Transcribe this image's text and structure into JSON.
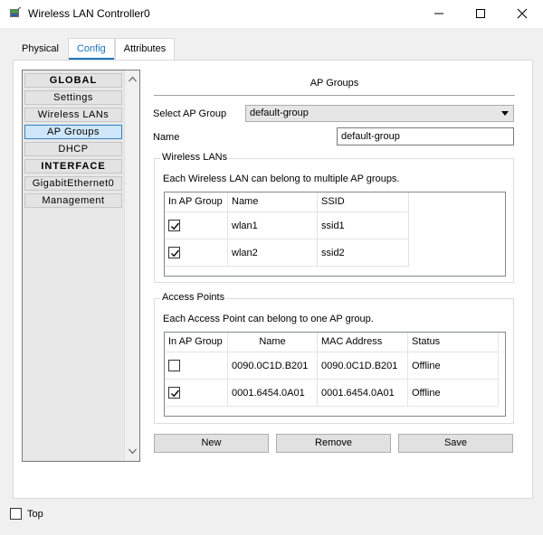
{
  "window": {
    "title": "Wireless LAN Controller0"
  },
  "tabs": [
    {
      "label": "Physical",
      "active": false
    },
    {
      "label": "Config",
      "active": true
    },
    {
      "label": "Attributes",
      "active": false
    }
  ],
  "sidebar": {
    "items": [
      {
        "label": "GLOBAL",
        "type": "header"
      },
      {
        "label": "Settings",
        "type": "item"
      },
      {
        "label": "Wireless LANs",
        "type": "item"
      },
      {
        "label": "AP Groups",
        "type": "item",
        "selected": true
      },
      {
        "label": "DHCP",
        "type": "item"
      },
      {
        "label": "INTERFACE",
        "type": "header"
      },
      {
        "label": "GigabitEthernet0",
        "type": "item"
      },
      {
        "label": "Management",
        "type": "item"
      }
    ]
  },
  "main": {
    "title": "AP Groups",
    "select_group_label": "Select AP Group",
    "select_group_value": "default-group",
    "name_label": "Name",
    "name_value": "default-group",
    "wlans": {
      "legend": "Wireless LANs",
      "description": "Each Wireless LAN can belong to multiple AP groups.",
      "columns": [
        "In AP Group",
        "Name",
        "SSID"
      ],
      "rows": [
        {
          "checked": true,
          "name": "wlan1",
          "ssid": "ssid1"
        },
        {
          "checked": true,
          "name": "wlan2",
          "ssid": "ssid2"
        }
      ]
    },
    "access_points": {
      "legend": "Access Points",
      "description": "Each Access Point can belong to one AP group.",
      "columns": [
        "In AP Group",
        "Name",
        "MAC Address",
        "Status"
      ],
      "rows": [
        {
          "checked": false,
          "name": "0090.0C1D.B201",
          "mac": "0090.0C1D.B201",
          "status": "Offline"
        },
        {
          "checked": true,
          "name": "0001.6454.0A01",
          "mac": "0001.6454.0A01",
          "status": "Offline"
        }
      ]
    },
    "buttons": {
      "new": "New",
      "remove": "Remove",
      "save": "Save"
    }
  },
  "footer": {
    "top_label": "Top",
    "top_checked": false
  },
  "colors": {
    "accent": "#1e73be",
    "selected_bg": "#cfe6f8"
  }
}
